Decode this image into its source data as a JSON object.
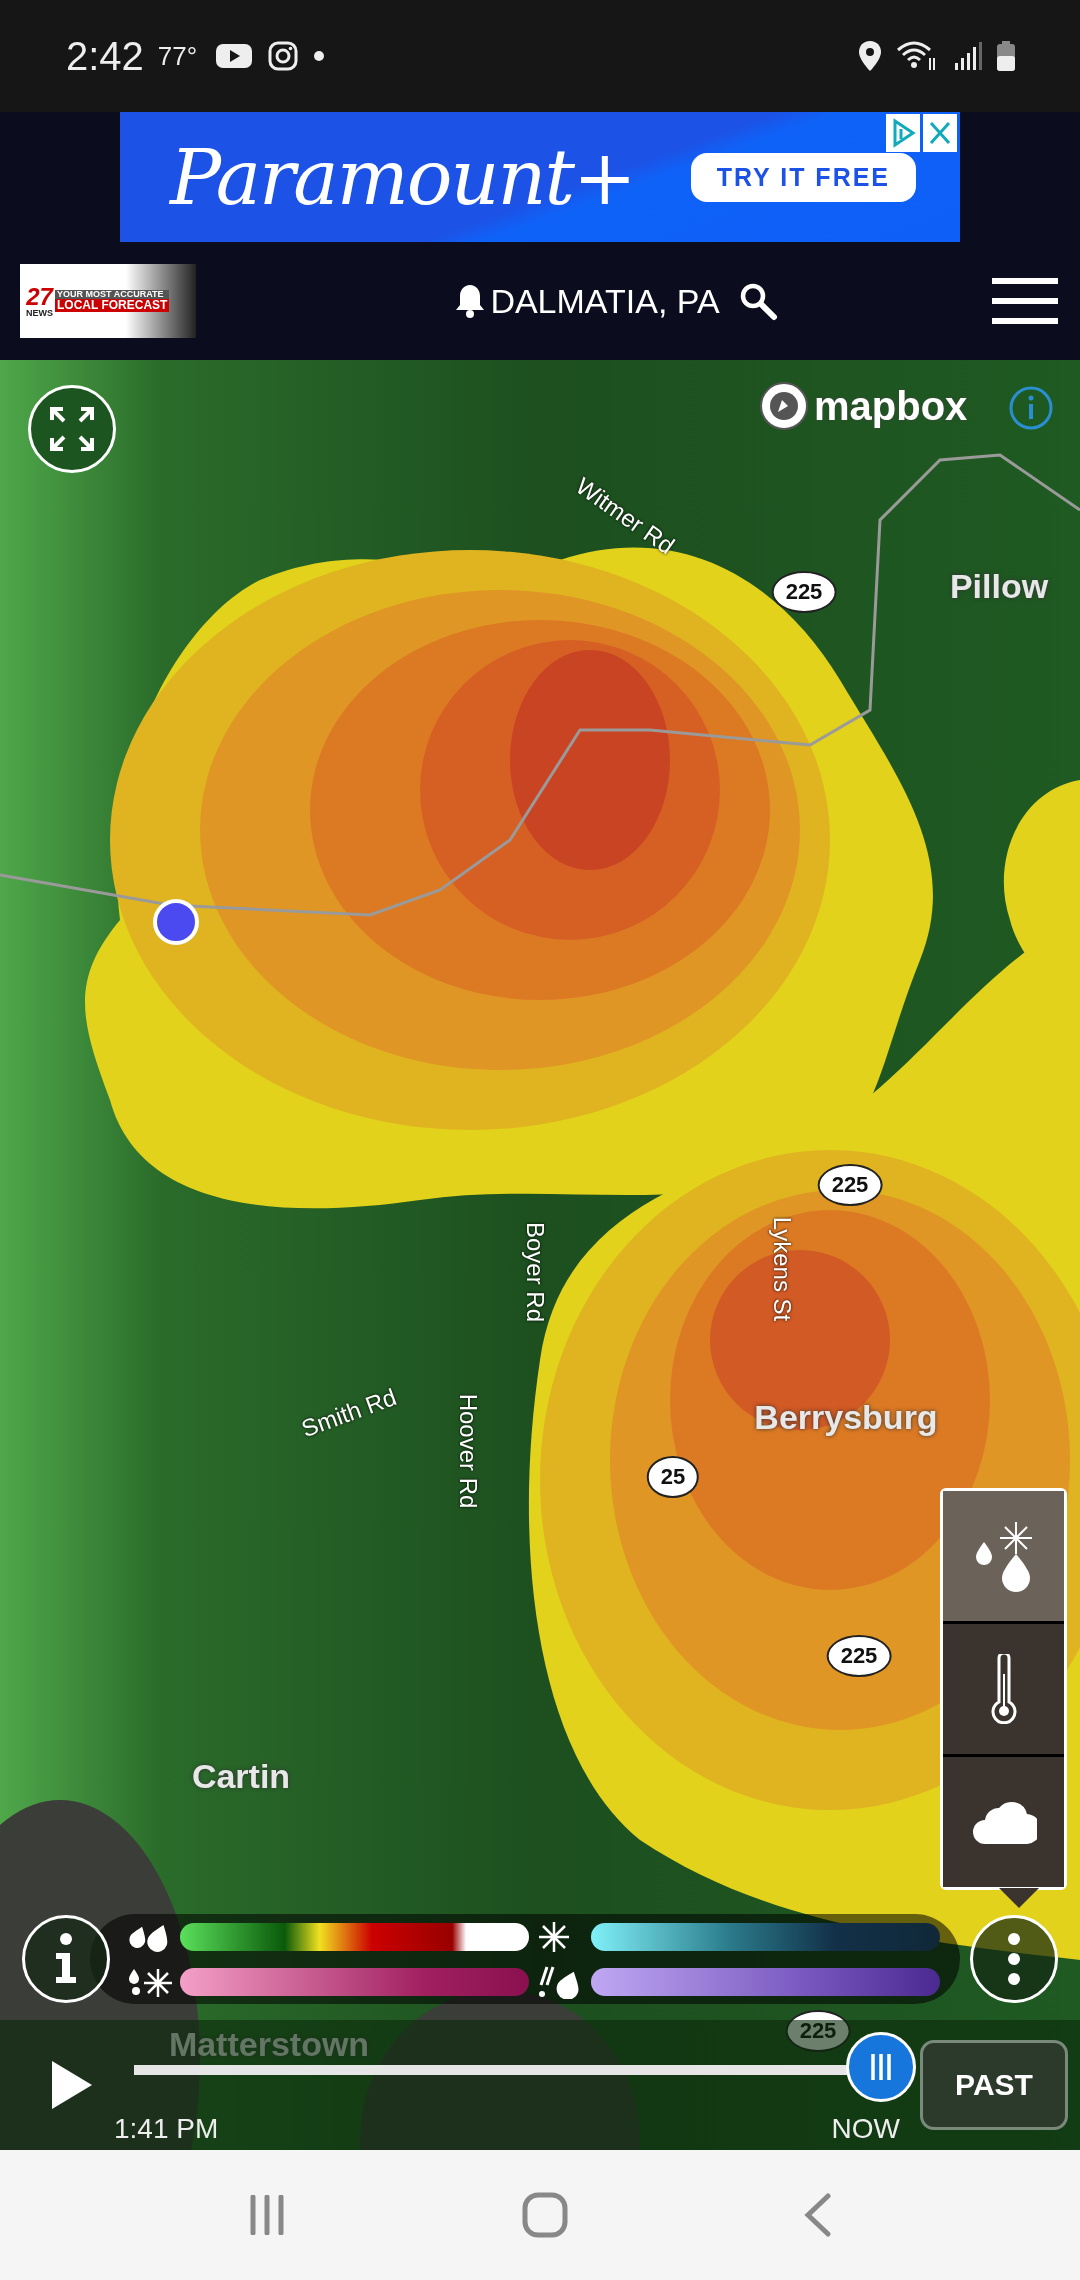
{
  "status_bar": {
    "time": "2:42",
    "temperature": "77°"
  },
  "ad": {
    "brand": "Paramount+",
    "cta": "TRY IT FREE"
  },
  "header": {
    "logo_number": "27",
    "logo_sub": "NEWS",
    "logo_line1": "YOUR MOST ACCURATE",
    "logo_line2": "LOCAL FORECAST",
    "location": "DALMATIA, PA"
  },
  "map": {
    "attribution": "mapbox",
    "labels": [
      {
        "kind": "road",
        "text": "Witmer Rd"
      },
      {
        "kind": "shield",
        "text": "225"
      },
      {
        "kind": "place",
        "text": "Pillow"
      },
      {
        "kind": "shield",
        "text": "225"
      },
      {
        "kind": "road",
        "text": "Boyer Rd"
      },
      {
        "kind": "road",
        "text": "Lykens St"
      },
      {
        "kind": "place",
        "text": "Berrysburg"
      },
      {
        "kind": "road",
        "text": "Smith Rd"
      },
      {
        "kind": "road",
        "text": "Hoover Rd"
      },
      {
        "kind": "shield",
        "text": "25"
      },
      {
        "kind": "shield",
        "text": "225"
      },
      {
        "kind": "place",
        "text": "Cartin"
      },
      {
        "kind": "place",
        "text": "Matterstown"
      },
      {
        "kind": "shield",
        "text": "225"
      }
    ]
  },
  "layers": [
    {
      "kind": "precipitation",
      "selected": true
    },
    {
      "kind": "temperature",
      "selected": false
    },
    {
      "kind": "clouds",
      "selected": false
    }
  ],
  "timeline": {
    "start": "1:41 PM",
    "end": "NOW",
    "level": 1,
    "button": "PAST"
  }
}
